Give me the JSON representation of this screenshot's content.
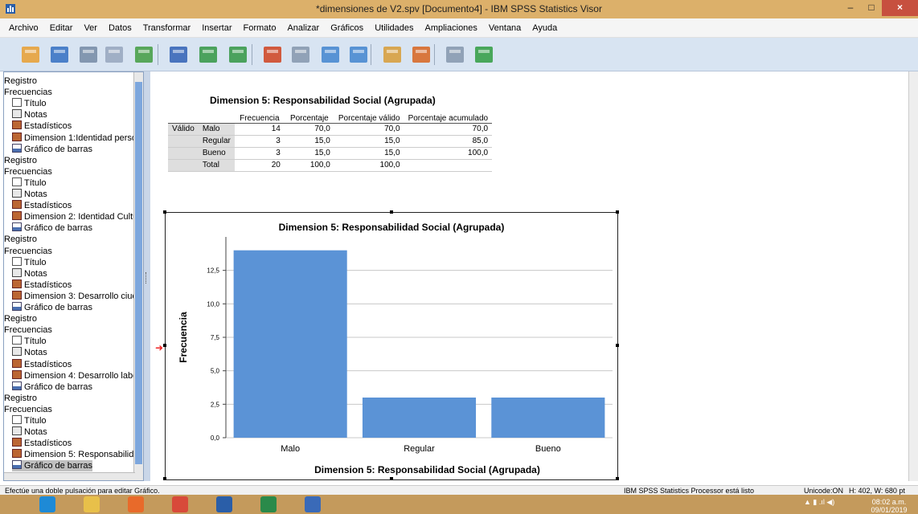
{
  "window": {
    "title": "*dimensiones de V2.spv [Documento4] - IBM SPSS Statistics Visor",
    "min_label": "–",
    "max_label": "□",
    "close_label": "×"
  },
  "menu": [
    "Archivo",
    "Editar",
    "Ver",
    "Datos",
    "Transformar",
    "Insertar",
    "Formato",
    "Analizar",
    "Gráficos",
    "Utilidades",
    "Ampliaciones",
    "Ventana",
    "Ayuda"
  ],
  "toolbar_icons": [
    "open-icon",
    "save-icon",
    "print-icon",
    "print-preview-icon",
    "export-icon",
    "recall-dialog-icon",
    "undo-icon",
    "redo-icon",
    "goto-data-icon",
    "goto-case-icon",
    "goto-variable-icon",
    "variables-icon",
    "show-outline-icon",
    "designate-window-icon",
    "hide-icon",
    "insert-icon"
  ],
  "outline": [
    {
      "label": "Registro",
      "type": "text",
      "indent": 0
    },
    {
      "label": "Frecuencias",
      "type": "text",
      "indent": 0
    },
    {
      "label": "Título",
      "type": "doc",
      "indent": 1
    },
    {
      "label": "Notas",
      "type": "notes",
      "indent": 1
    },
    {
      "label": "Estadísticos",
      "type": "table",
      "indent": 1
    },
    {
      "label": "Dimension 1:Identidad perso",
      "type": "table",
      "indent": 1
    },
    {
      "label": "Gráfico de barras",
      "type": "chart",
      "indent": 1
    },
    {
      "label": "Registro",
      "type": "text",
      "indent": 0
    },
    {
      "label": "Frecuencias",
      "type": "text",
      "indent": 0
    },
    {
      "label": "Título",
      "type": "doc",
      "indent": 1
    },
    {
      "label": "Notas",
      "type": "notes",
      "indent": 1
    },
    {
      "label": "Estadísticos",
      "type": "table",
      "indent": 1
    },
    {
      "label": "Dimension 2: Identidad Cultu",
      "type": "table",
      "indent": 1
    },
    {
      "label": "Gráfico de barras",
      "type": "chart",
      "indent": 1
    },
    {
      "label": "Registro",
      "type": "text",
      "indent": 0
    },
    {
      "label": "Frecuencias",
      "type": "text",
      "indent": 0
    },
    {
      "label": "Título",
      "type": "doc",
      "indent": 1
    },
    {
      "label": "Notas",
      "type": "notes",
      "indent": 1
    },
    {
      "label": "Estadísticos",
      "type": "table",
      "indent": 1
    },
    {
      "label": "Dimension 3: Desarrollo ciud",
      "type": "table",
      "indent": 1
    },
    {
      "label": "Gráfico de barras",
      "type": "chart",
      "indent": 1
    },
    {
      "label": "Registro",
      "type": "text",
      "indent": 0
    },
    {
      "label": "Frecuencias",
      "type": "text",
      "indent": 0
    },
    {
      "label": "Título",
      "type": "doc",
      "indent": 1
    },
    {
      "label": "Notas",
      "type": "notes",
      "indent": 1
    },
    {
      "label": "Estadísticos",
      "type": "table",
      "indent": 1
    },
    {
      "label": "Dimension 4: Desarrollo labo",
      "type": "table",
      "indent": 1
    },
    {
      "label": "Gráfico de barras",
      "type": "chart",
      "indent": 1
    },
    {
      "label": "Registro",
      "type": "text",
      "indent": 0
    },
    {
      "label": "Frecuencias",
      "type": "text",
      "indent": 0
    },
    {
      "label": "Título",
      "type": "doc",
      "indent": 1
    },
    {
      "label": "Notas",
      "type": "notes",
      "indent": 1
    },
    {
      "label": "Estadísticos",
      "type": "table",
      "indent": 1
    },
    {
      "label": "Dimension 5: Responsabilid",
      "type": "table",
      "indent": 1
    },
    {
      "label": "Gráfico de barras",
      "type": "chart",
      "indent": 1,
      "selected": true
    }
  ],
  "freq_table": {
    "title": "Dimension 5: Responsabilidad Social (Agrupada)",
    "headers": [
      "Frecuencia",
      "Porcentaje",
      "Porcentaje válido",
      "Porcentaje acumulado"
    ],
    "group_label": "Válido",
    "rows": [
      {
        "label": "Malo",
        "freq": "14",
        "pct": "70,0",
        "valid": "70,0",
        "cum": "70,0"
      },
      {
        "label": "Regular",
        "freq": "3",
        "pct": "15,0",
        "valid": "15,0",
        "cum": "85,0"
      },
      {
        "label": "Bueno",
        "freq": "3",
        "pct": "15,0",
        "valid": "15,0",
        "cum": "100,0"
      },
      {
        "label": "Total",
        "freq": "20",
        "pct": "100,0",
        "valid": "100,0",
        "cum": ""
      }
    ]
  },
  "chart_data": {
    "type": "bar",
    "title": "Dimension 5: Responsabilidad Social (Agrupada)",
    "xlabel": "Dimension 5: Responsabilidad Social (Agrupada)",
    "ylabel": "Frecuencia",
    "categories": [
      "Malo",
      "Regular",
      "Bueno"
    ],
    "values": [
      14,
      3,
      3
    ],
    "ylim": [
      0,
      15
    ],
    "yticks": [
      0,
      2.5,
      5,
      7.5,
      10,
      12.5
    ],
    "ytick_labels": [
      "0,0",
      "2,5",
      "5,0",
      "7,5",
      "10,0",
      "12,5"
    ],
    "bar_color": "#5b93d6",
    "grid": true
  },
  "status": {
    "hint": "Efectúe una doble pulsación para editar Gráfico.",
    "processor": "IBM SPSS Statistics Processor está listo",
    "unicode": "Unicode:ON",
    "size": "H: 402, W: 680 pt"
  },
  "taskbar": {
    "apps": [
      "ie-icon",
      "file-explorer-icon",
      "firefox-icon",
      "chrome-icon",
      "word-icon",
      "excel-icon",
      "spss-icon"
    ],
    "time": "08:02 a.m.",
    "date": "09/01/2019"
  }
}
